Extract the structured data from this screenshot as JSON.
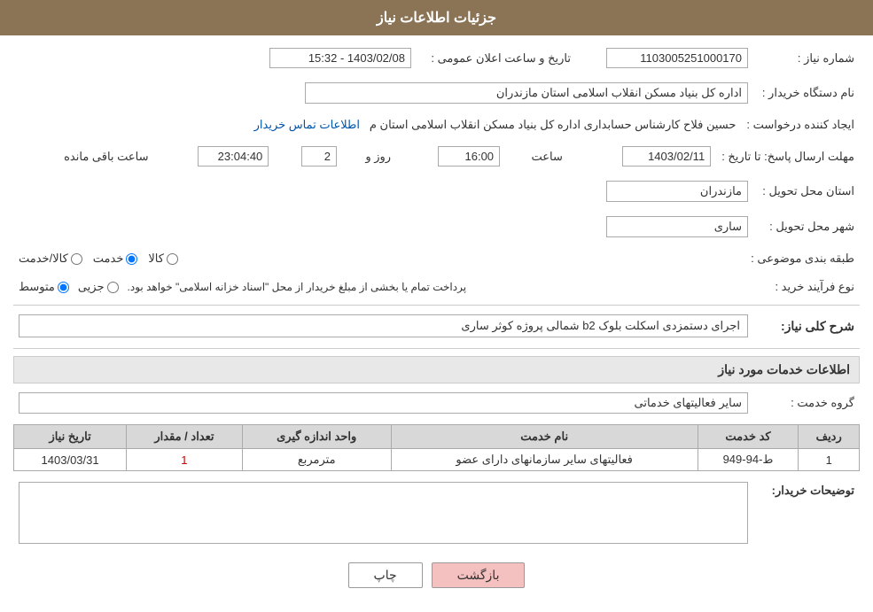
{
  "header": {
    "title": "جزئیات اطلاعات نیاز"
  },
  "fields": {
    "order_number_label": "شماره نیاز :",
    "order_number_value": "1103005251000170",
    "date_label": "تاریخ و ساعت اعلان عمومی :",
    "date_value": "1403/02/08 - 15:32",
    "organization_label": "نام دستگاه خریدار :",
    "organization_value": "اداره کل بنیاد مسکن انقلاب اسلامی استان مازندران",
    "creator_label": "ایجاد کننده درخواست :",
    "creator_value": "حسین فلاح کارشناس حسابداری اداره کل بنیاد مسکن انقلاب اسلامی استان م",
    "creator_link": "اطلاعات تماس خریدار",
    "response_deadline_label": "مهلت ارسال پاسخ: تا تاریخ :",
    "response_date": "1403/02/11",
    "response_time_label": "ساعت",
    "response_time": "16:00",
    "response_day_label": "روز و",
    "response_day": "2",
    "response_remaining_label": "ساعت باقی مانده",
    "response_remaining": "23:04:40",
    "delivery_province_label": "استان محل تحویل :",
    "delivery_province": "مازندران",
    "delivery_city_label": "شهر محل تحویل :",
    "delivery_city": "ساری",
    "category_label": "طبقه بندی موضوعی :",
    "category_kala": "کالا",
    "category_khadamat": "خدمت",
    "category_kala_khadamat": "کالا/خدمت",
    "process_type_label": "نوع فرآیند خرید :",
    "process_jozvi": "جزیی",
    "process_motavaset": "متوسط",
    "process_note": "پرداخت تمام یا بخشی از مبلغ خریدار از محل \"اسناد خزانه اسلامی\" خواهد بود.",
    "general_description_section": "شرح کلی نیاز:",
    "general_description": "اجرای دستمزدی اسکلت بلوک b2 شمالی پروژه کوثر ساری",
    "services_section": "اطلاعات خدمات مورد نیاز",
    "service_group_label": "گروه خدمت :",
    "service_group": "سایر فعالیتهای خدماتی",
    "table": {
      "headers": [
        "ردیف",
        "کد خدمت",
        "نام خدمت",
        "واحد اندازه گیری",
        "تعداد / مقدار",
        "تاریخ نیاز"
      ],
      "rows": [
        {
          "row": "1",
          "code": "ط-94-949",
          "name": "فعالیتهای سایر سازمانهای دارای عضو",
          "unit": "مترمربع",
          "quantity": "1",
          "date": "1403/03/31"
        }
      ]
    },
    "buyer_notes_label": "توضیحات خریدار:",
    "buyer_notes": ""
  },
  "buttons": {
    "print": "چاپ",
    "back": "بازگشت"
  }
}
